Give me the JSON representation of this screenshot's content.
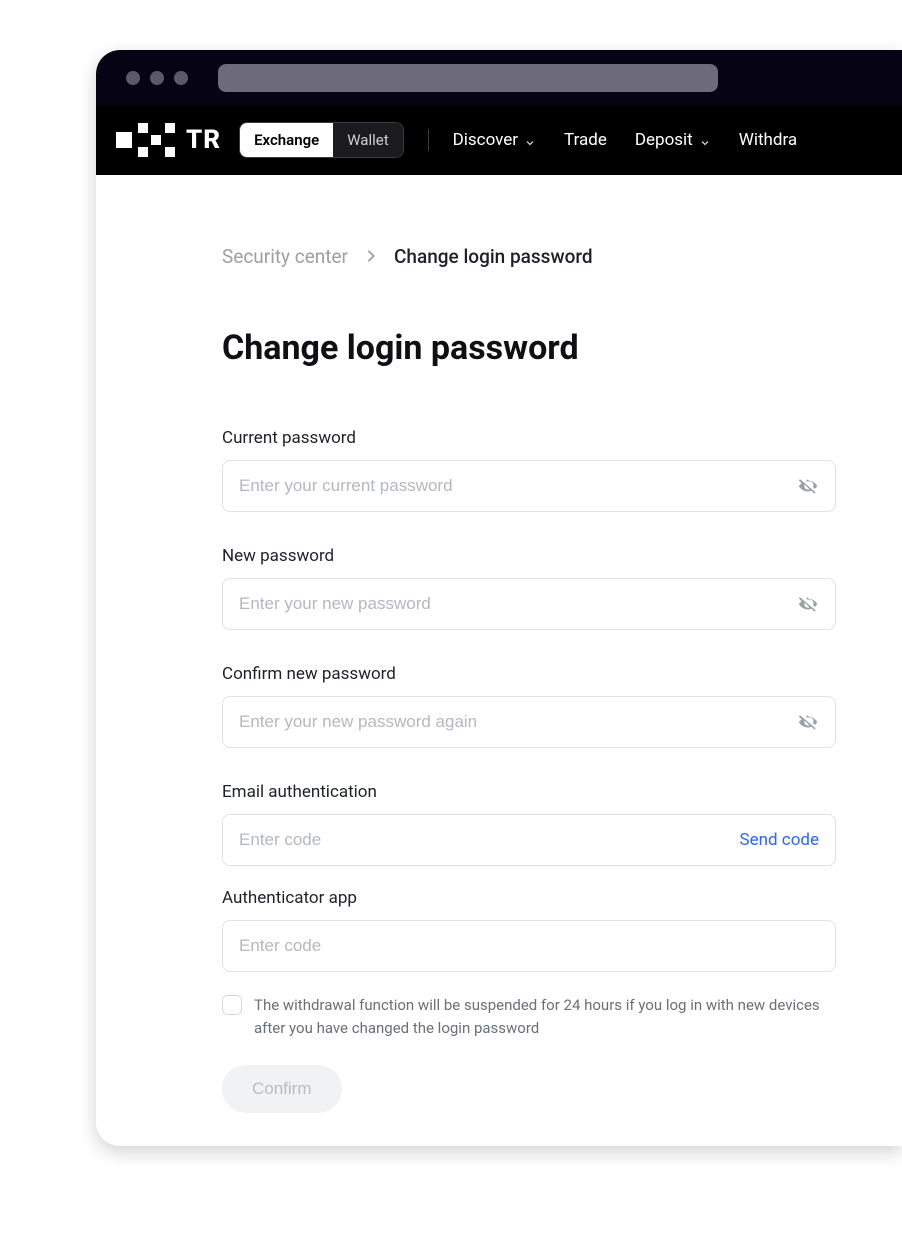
{
  "mode_toggle": {
    "exchange": "Exchange",
    "wallet": "Wallet"
  },
  "nav": {
    "discover": "Discover",
    "trade": "Trade",
    "deposit": "Deposit",
    "withdraw": "Withdra"
  },
  "breadcrumbs": {
    "parent": "Security center",
    "current": "Change login password"
  },
  "page_title": "Change login password",
  "fields": {
    "current_password": {
      "label": "Current password",
      "placeholder": "Enter your current password"
    },
    "new_password": {
      "label": "New password",
      "placeholder": "Enter your new password"
    },
    "confirm_password": {
      "label": "Confirm new password",
      "placeholder": "Enter your new password again"
    },
    "email_auth": {
      "label": "Email authentication",
      "placeholder": "Enter code",
      "send_code": "Send code"
    },
    "authenticator": {
      "label": "Authenticator app",
      "placeholder": "Enter code"
    }
  },
  "notice": "The withdrawal function will be suspended for 24 hours if you log in with new devices after you have changed the login password",
  "confirm_button": "Confirm"
}
